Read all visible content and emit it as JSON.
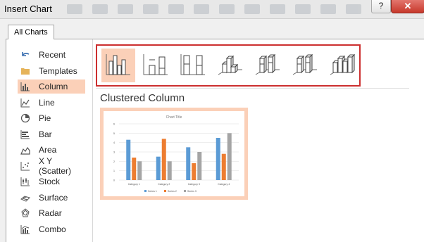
{
  "dialog": {
    "title": "Insert Chart",
    "help_label": "?",
    "close_label": "✕"
  },
  "tabs": [
    {
      "label": "All Charts"
    }
  ],
  "sidebar": {
    "items": [
      {
        "label": "Recent",
        "icon": "undo-arrow-icon"
      },
      {
        "label": "Templates",
        "icon": "folder-icon"
      },
      {
        "label": "Column",
        "icon": "column-chart-icon",
        "selected": true
      },
      {
        "label": "Line",
        "icon": "line-chart-icon"
      },
      {
        "label": "Pie",
        "icon": "pie-chart-icon"
      },
      {
        "label": "Bar",
        "icon": "bar-chart-icon"
      },
      {
        "label": "Area",
        "icon": "area-chart-icon"
      },
      {
        "label": "X Y (Scatter)",
        "icon": "scatter-chart-icon"
      },
      {
        "label": "Stock",
        "icon": "stock-chart-icon"
      },
      {
        "label": "Surface",
        "icon": "surface-chart-icon"
      },
      {
        "label": "Radar",
        "icon": "radar-chart-icon"
      },
      {
        "label": "Combo",
        "icon": "combo-chart-icon"
      }
    ]
  },
  "chart_types": [
    {
      "icon": "clustered-column-icon",
      "selected": true
    },
    {
      "icon": "stacked-column-icon"
    },
    {
      "icon": "100-stacked-column-icon"
    },
    {
      "icon": "3d-clustered-column-icon"
    },
    {
      "icon": "3d-stacked-column-icon"
    },
    {
      "icon": "3d-100-stacked-column-icon"
    },
    {
      "icon": "3d-column-icon"
    }
  ],
  "subtype_title": "Clustered Column",
  "colors": {
    "selected_bg": "#fbd0b8",
    "highlight_border": "#cc2f2f",
    "series1": "#5b9bd5",
    "series2": "#ed7d31",
    "series3": "#a5a5a5"
  },
  "chart_data": {
    "type": "bar",
    "title": "Chart Title",
    "categories": [
      "Category 1",
      "Category 2",
      "Category 3",
      "Category 4"
    ],
    "series": [
      {
        "name": "Series 1",
        "values": [
          4.3,
          2.5,
          3.5,
          4.5
        ]
      },
      {
        "name": "Series 2",
        "values": [
          2.4,
          4.4,
          1.8,
          2.8
        ]
      },
      {
        "name": "Series 3",
        "values": [
          2,
          2,
          3,
          5
        ]
      }
    ],
    "ylim": [
      0,
      6
    ],
    "yticks": [
      0,
      1,
      2,
      3,
      4,
      5,
      6
    ],
    "legend": "bottom",
    "grid": true
  }
}
